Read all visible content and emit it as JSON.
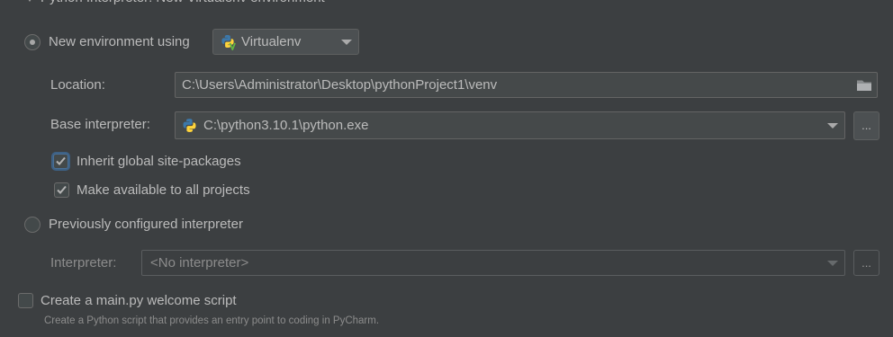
{
  "theme": {
    "background": "#3c3f41",
    "text": "#bbbbbb",
    "disabled_text": "#8c8c8c",
    "focus_ring": "#3d6185"
  },
  "section_header": {
    "title": "Python Interpreter: New Virtualenv environment",
    "icon": "collapse-chevron-icon"
  },
  "new_environment": {
    "label": "New environment using",
    "selected": true,
    "environment_tool": {
      "value": "Virtualenv",
      "icon": "virtualenv-icon"
    }
  },
  "location": {
    "label": "Location:",
    "value": "C:\\Users\\Administrator\\Desktop\\pythonProject1\\venv",
    "icon": "folder-icon"
  },
  "base_interpreter": {
    "label": "Base interpreter:",
    "value": "C:\\python3.10.1\\python.exe",
    "icon": "python-icon",
    "browse_label": "..."
  },
  "inherit_site_packages": {
    "label": "Inherit global site-packages",
    "checked": true,
    "focused": true
  },
  "make_available": {
    "label": "Make available to all projects",
    "checked": true
  },
  "previously_configured": {
    "label": "Previously configured interpreter",
    "selected": false
  },
  "existing_interpreter": {
    "label": "Interpreter:",
    "value": "<No interpreter>",
    "browse_label": "...",
    "enabled": false
  },
  "welcome_script": {
    "label": "Create a main.py welcome script",
    "checked": false,
    "description": "Create a Python script that provides an entry point to coding in PyCharm."
  }
}
